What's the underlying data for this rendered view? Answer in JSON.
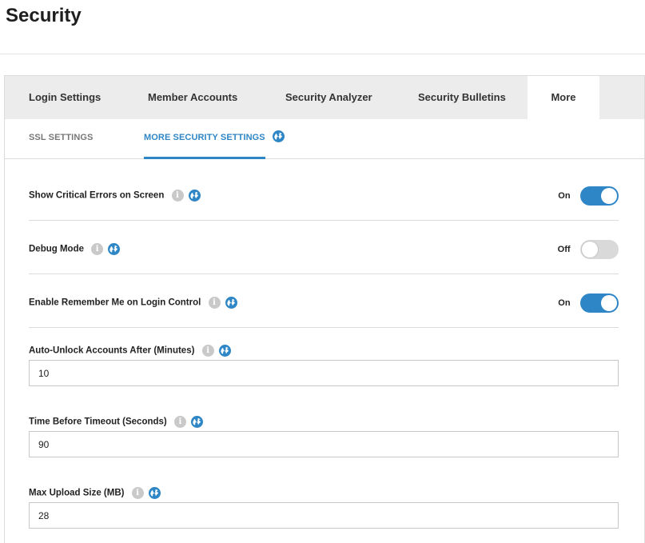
{
  "page": {
    "title": "Security"
  },
  "tabs": [
    {
      "label": "Login Settings"
    },
    {
      "label": "Member Accounts"
    },
    {
      "label": "Security Analyzer"
    },
    {
      "label": "Security Bulletins"
    },
    {
      "label": "More",
      "active": true
    }
  ],
  "subtabs": [
    {
      "label": "SSL SETTINGS"
    },
    {
      "label": "MORE SECURITY SETTINGS",
      "active": true
    }
  ],
  "settings": {
    "critical_errors": {
      "label": "Show Critical Errors on Screen",
      "state": "On"
    },
    "debug_mode": {
      "label": "Debug Mode",
      "state": "Off"
    },
    "remember_me": {
      "label": "Enable Remember Me on Login Control",
      "state": "On"
    },
    "auto_unlock": {
      "label": "Auto-Unlock Accounts After (Minutes)",
      "value": "10"
    },
    "timeout": {
      "label": "Time Before Timeout (Seconds)",
      "value": "90"
    },
    "max_upload": {
      "label": "Max Upload Size (MB)",
      "value": "28"
    }
  },
  "icons": {
    "info": "info-icon",
    "globe": "globe-icon"
  },
  "colors": {
    "accent": "#2f86c6",
    "toggle_off": "#d9d9d9",
    "tab_bar": "#ececec"
  }
}
